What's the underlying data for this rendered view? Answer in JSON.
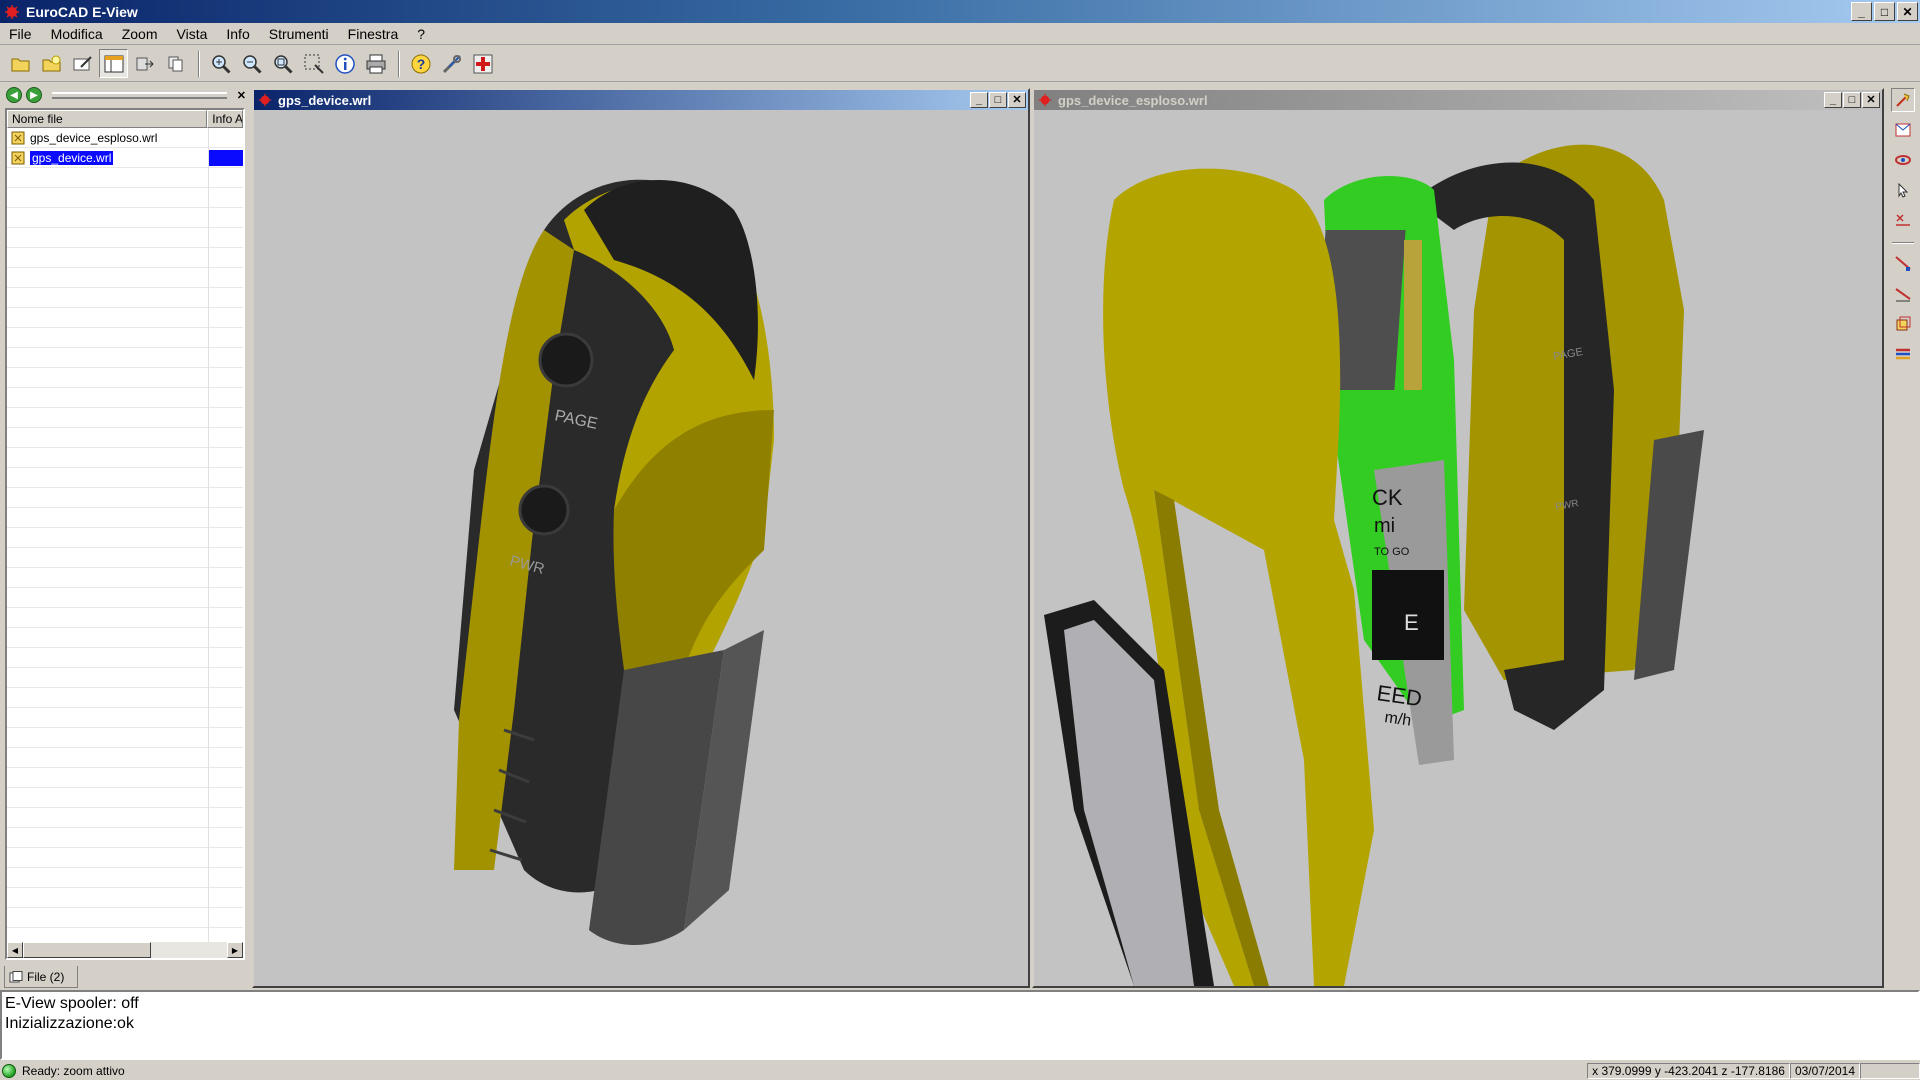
{
  "window": {
    "title": "EuroCAD E-View",
    "minimize": "_",
    "maximize": "□",
    "close": "✕"
  },
  "menu": {
    "items": [
      "File",
      "Modifica",
      "Zoom",
      "Vista",
      "Info",
      "Strumenti",
      "Finestra",
      "?"
    ]
  },
  "toolbar": {
    "buttons": [
      "open-folder-icon",
      "open-file-icon",
      "edit-icon",
      "layout-icon",
      "export-icon",
      "copy-icon",
      "zoom-in-icon",
      "zoom-out-icon",
      "zoom-all-icon",
      "zoom-window-icon",
      "info-icon",
      "print-icon",
      "help-icon",
      "tools-icon",
      "add-icon"
    ]
  },
  "file_panel": {
    "columns": [
      "Nome file",
      "Info A"
    ],
    "files": [
      {
        "name": "gps_device_esploso.wrl",
        "selected": false
      },
      {
        "name": "gps_device.wrl",
        "selected": true
      }
    ],
    "tab_label": "File (2)"
  },
  "viewers": [
    {
      "title": "gps_device.wrl",
      "active": true
    },
    {
      "title": "gps_device_esploso.wrl",
      "active": false
    }
  ],
  "model": {
    "labels": {
      "page": "PAGE",
      "pwr": "PWR"
    },
    "screen_text": {
      "line1": "CK",
      "line2": "mi",
      "line3": "TO GO",
      "line4": "E",
      "line5": "EED",
      "line6": "m/h"
    }
  },
  "log": {
    "lines": [
      "E-View spooler: off",
      "Inizializzazione:ok"
    ]
  },
  "status": {
    "text": "Ready: zoom attivo",
    "coords": "x 379.0999  y -423.2041  z -177.8186",
    "date": "03/07/2014"
  },
  "colors": {
    "yellow": "#b8a800",
    "green": "#33cc22",
    "dark": "#2e2e2e",
    "viewport_bg": "#c3c3c3",
    "active_title": "#0a246a"
  }
}
